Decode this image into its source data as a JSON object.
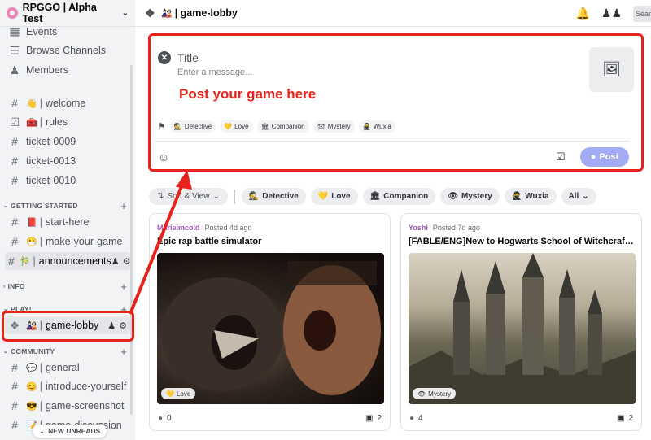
{
  "server": {
    "name": "RPGGO | Alpha Test"
  },
  "sidebar": {
    "top_items": [
      {
        "label": "Events"
      },
      {
        "label": "Browse Channels"
      },
      {
        "label": "Members"
      }
    ],
    "channels_top": [
      {
        "emoji": "👋",
        "label": "welcome"
      },
      {
        "emoji": "🧰",
        "label": "rules"
      },
      {
        "emoji": "",
        "label": "ticket-0009"
      },
      {
        "emoji": "",
        "label": "ticket-0013"
      },
      {
        "emoji": "",
        "label": "ticket-0010"
      }
    ],
    "categories": {
      "getting_started": "GETTING STARTED",
      "info": "INFO",
      "play": "PLAY!",
      "community": "COMMUNITY"
    },
    "getting_started_channels": [
      {
        "emoji": "📕",
        "label": "start-here"
      },
      {
        "emoji": "😷",
        "label": "make-your-game"
      },
      {
        "emoji": "🎋",
        "label": "announcements"
      }
    ],
    "play_channels": [
      {
        "emoji": "🎎",
        "label": "game-lobby"
      }
    ],
    "community_channels": [
      {
        "emoji": "💬",
        "label": "general"
      },
      {
        "emoji": "😊",
        "label": "introduce-yourself"
      },
      {
        "emoji": "😎",
        "label": "game-screenshot"
      },
      {
        "emoji": "📝",
        "label": "game-discussion"
      }
    ],
    "new_unreads": "NEW UNREADS"
  },
  "header": {
    "channel_emoji": "🎎",
    "channel_name": "| game-lobby",
    "search_placeholder": "Sear"
  },
  "composer": {
    "title_placeholder": "Title",
    "message_placeholder": "Enter a message...",
    "annotation": "Post your game here",
    "tags": [
      {
        "emoji": "🕵",
        "label": "Detective"
      },
      {
        "emoji": "💛",
        "label": "Love"
      },
      {
        "emoji": "🏛",
        "label": "Companion"
      },
      {
        "emoji": "👁",
        "label": "Mystery"
      },
      {
        "emoji": "🥷",
        "label": "Wuxia"
      }
    ],
    "post_label": "Post"
  },
  "filters": {
    "sort_label": "Sort & View",
    "tags": [
      {
        "emoji": "🕵",
        "label": "Detective"
      },
      {
        "emoji": "💛",
        "label": "Love"
      },
      {
        "emoji": "🏛",
        "label": "Companion"
      },
      {
        "emoji": "👁",
        "label": "Mystery"
      },
      {
        "emoji": "🥷",
        "label": "Wuxia"
      }
    ],
    "all_label": "All"
  },
  "posts": [
    {
      "author": "Marieimcold",
      "time": "Posted 4d ago",
      "title": "Epic rap battle simulator",
      "tag": {
        "emoji": "💛",
        "label": "Love"
      },
      "replies": "0",
      "players": "2"
    },
    {
      "author": "Yoshi",
      "time": "Posted 7d ago",
      "title": "[FABLE/ENG]New to Hogwarts School of Witchcraft a...",
      "tag": {
        "emoji": "👁",
        "label": "Mystery"
      },
      "replies": "4",
      "players": "2"
    }
  ],
  "colors": {
    "highlight": "#e8231c",
    "post_button": "#a4abf5"
  }
}
